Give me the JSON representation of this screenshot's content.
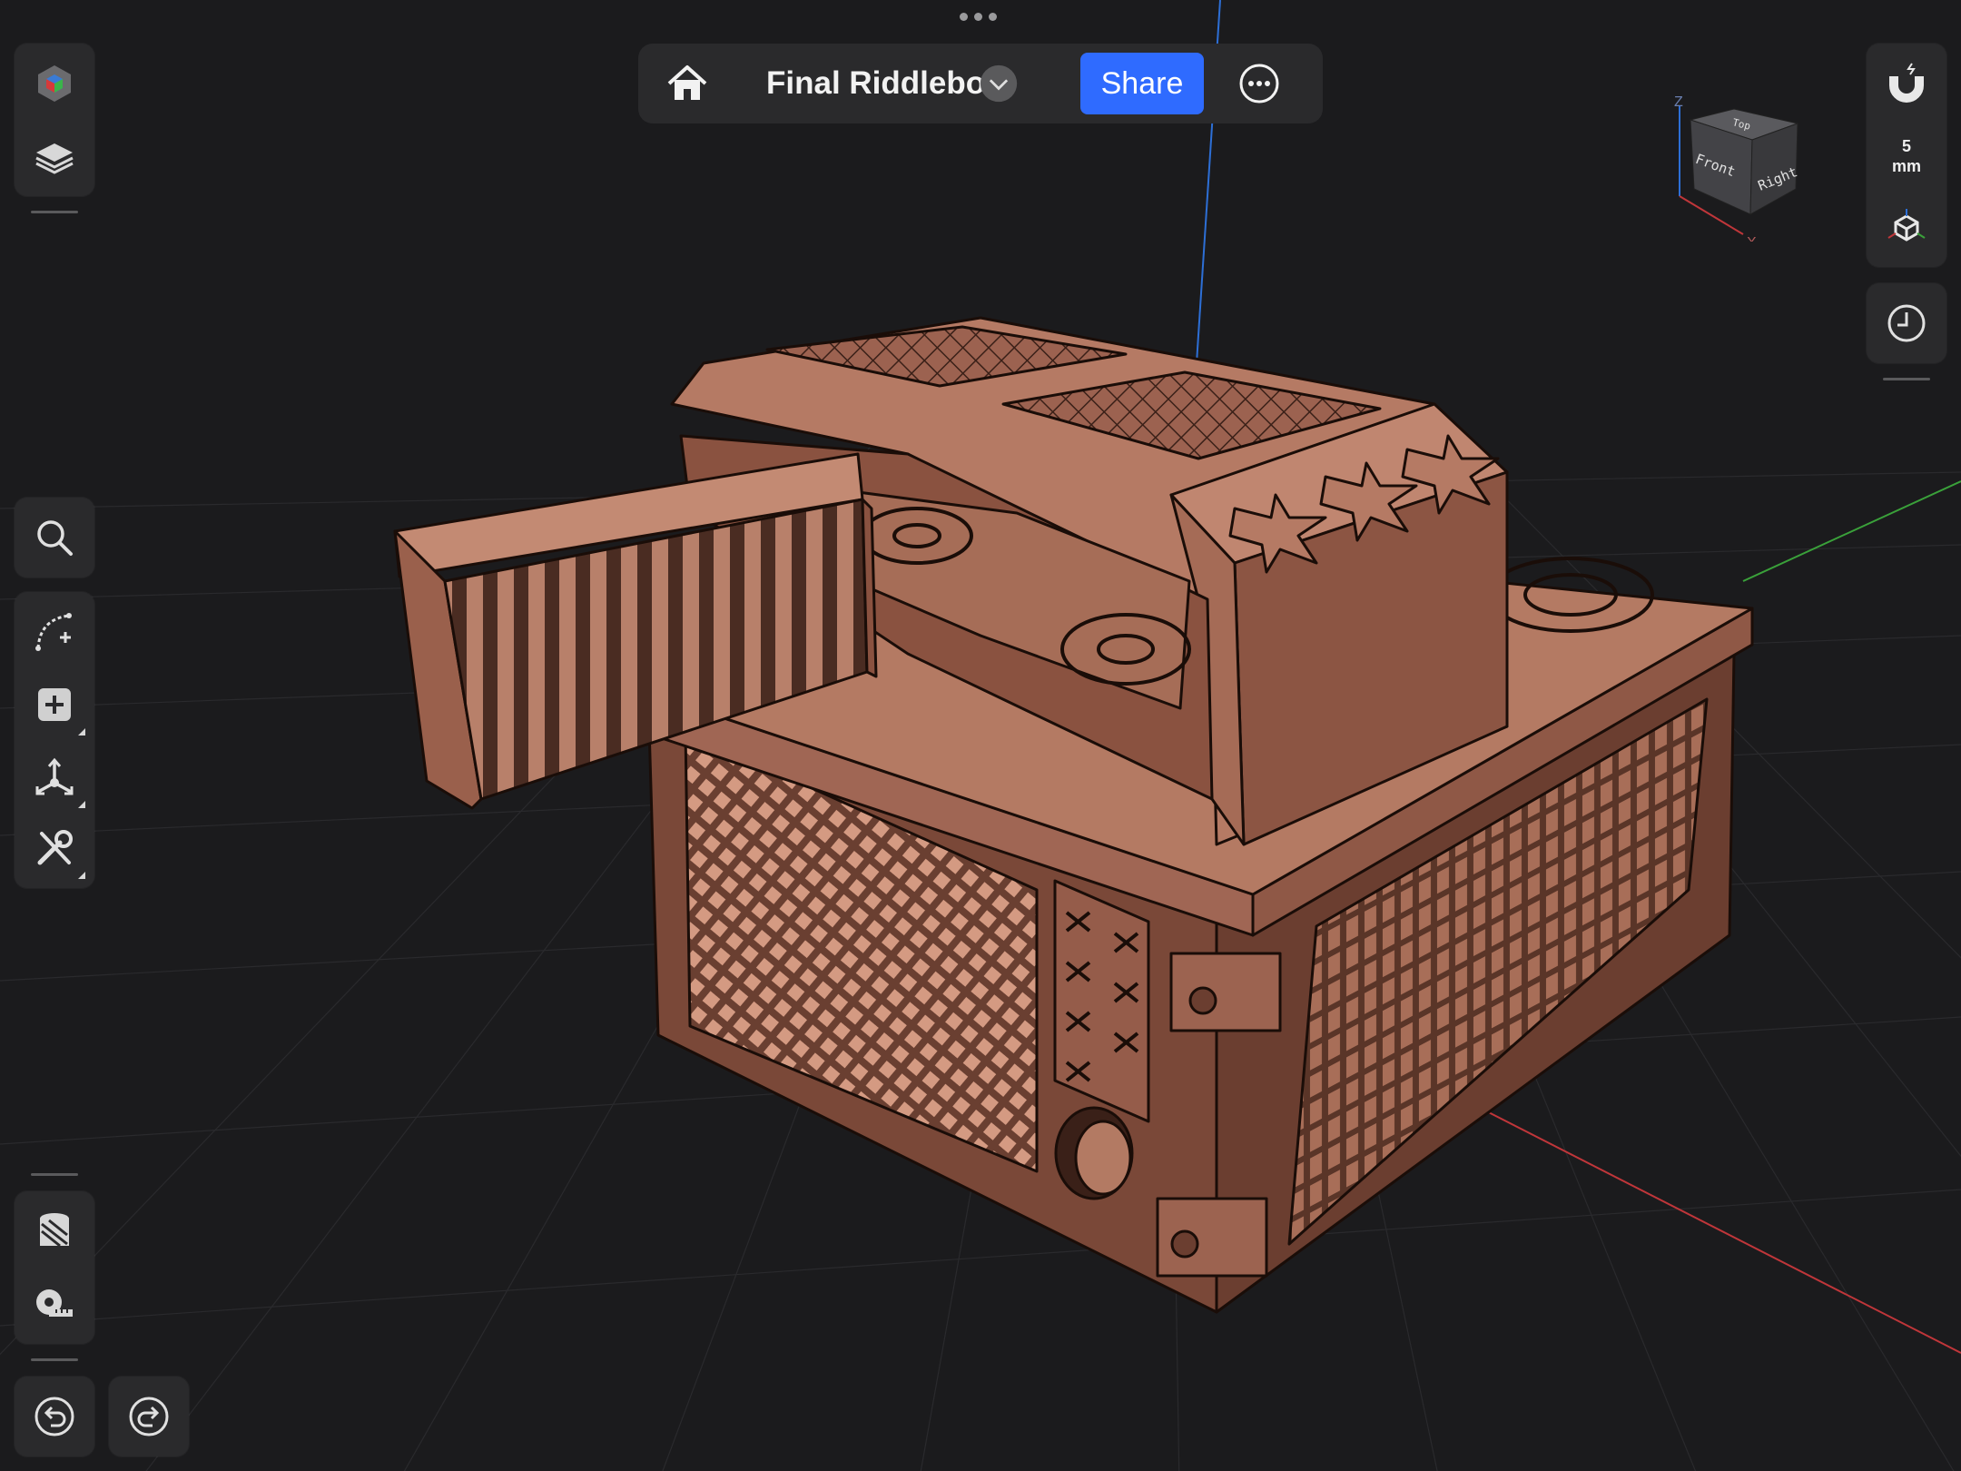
{
  "header": {
    "title": "Final Riddlebox",
    "share_label": "Share"
  },
  "right_panel": {
    "snap_value": "5",
    "snap_unit": "mm"
  },
  "view_cube": {
    "top_label": "Top",
    "front_label": "Front",
    "right_label": "Right",
    "axis_z": "Z",
    "axis_x": "X"
  },
  "icons": {
    "home": "home-icon",
    "title_dropdown": "chevron-down-icon",
    "more": "more-options-icon",
    "app": "colored-cube-icon",
    "layers": "layers-icon",
    "search": "search-icon",
    "sketch": "sketch-curve-icon",
    "add": "add-shape-icon",
    "transform": "transform-icon",
    "tools": "tools-icon",
    "material": "material-icon",
    "measure": "measure-tape-icon",
    "undo": "undo-icon",
    "redo": "redo-icon",
    "snap": "magnet-icon",
    "view_mode": "view-mode-icon",
    "history": "history-clock-icon"
  },
  "colors": {
    "accent": "#2f6bff",
    "panel": "#2a2a2c",
    "background": "#1b1b1d",
    "model": "#a86e58",
    "axis_x": "#c0363a",
    "axis_y": "#3aa13a",
    "axis_z": "#2d6fd6"
  }
}
